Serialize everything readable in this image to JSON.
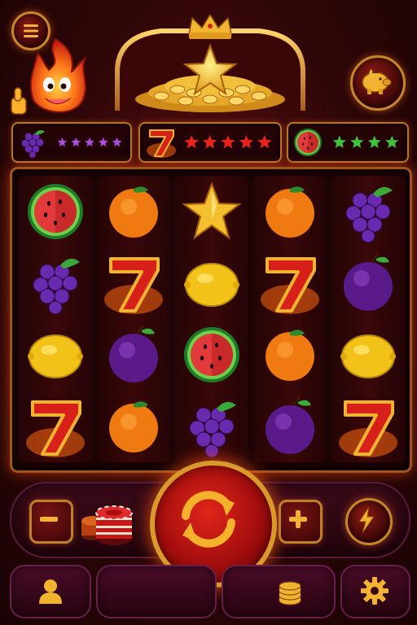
{
  "game": {
    "title": "",
    "theme_colors": {
      "gold": "#e8a92c",
      "red": "#d3231a",
      "purple": "#5b1a8a",
      "dark": "#1c0305"
    }
  },
  "top_bar": {
    "menu_icon": "hamburger-menu-icon",
    "mascot_icon": "fire-mascot-thumbs-up-icon",
    "jackpot_icon": "crown-coin-pile-star-icon",
    "piggy_icon": "piggy-bank-icon"
  },
  "collect_meters": [
    {
      "symbol": "grape",
      "stars_total": 5,
      "stars_color": "#a84de0"
    },
    {
      "symbol": "seven",
      "stars_total": 5,
      "stars_color": "#e8231a"
    },
    {
      "symbol": "watermelon",
      "stars_total": 4,
      "stars_color": "#3fc23a"
    }
  ],
  "reels": [
    [
      "watermelon",
      "grape",
      "lemon",
      "seven"
    ],
    [
      "orange",
      "seven",
      "plum",
      "orange"
    ],
    [
      "star",
      "lemon",
      "watermelon",
      "grape"
    ],
    [
      "orange",
      "seven",
      "orange",
      "plum"
    ],
    [
      "grape",
      "plum",
      "lemon",
      "seven"
    ]
  ],
  "controls": {
    "minus_icon": "minus-icon",
    "plus_icon": "plus-icon",
    "spin_icon": "refresh-arrows-icon",
    "turbo_icon": "lightning-bolt-icon",
    "chips_icon": "casino-chips-stack-icon"
  },
  "nav": [
    {
      "id": "profile",
      "icon": "user-icon"
    },
    {
      "id": "mid",
      "icon": ""
    },
    {
      "id": "coins",
      "icon": "coin-stack-icon"
    },
    {
      "id": "settings",
      "icon": "gear-icon"
    }
  ]
}
